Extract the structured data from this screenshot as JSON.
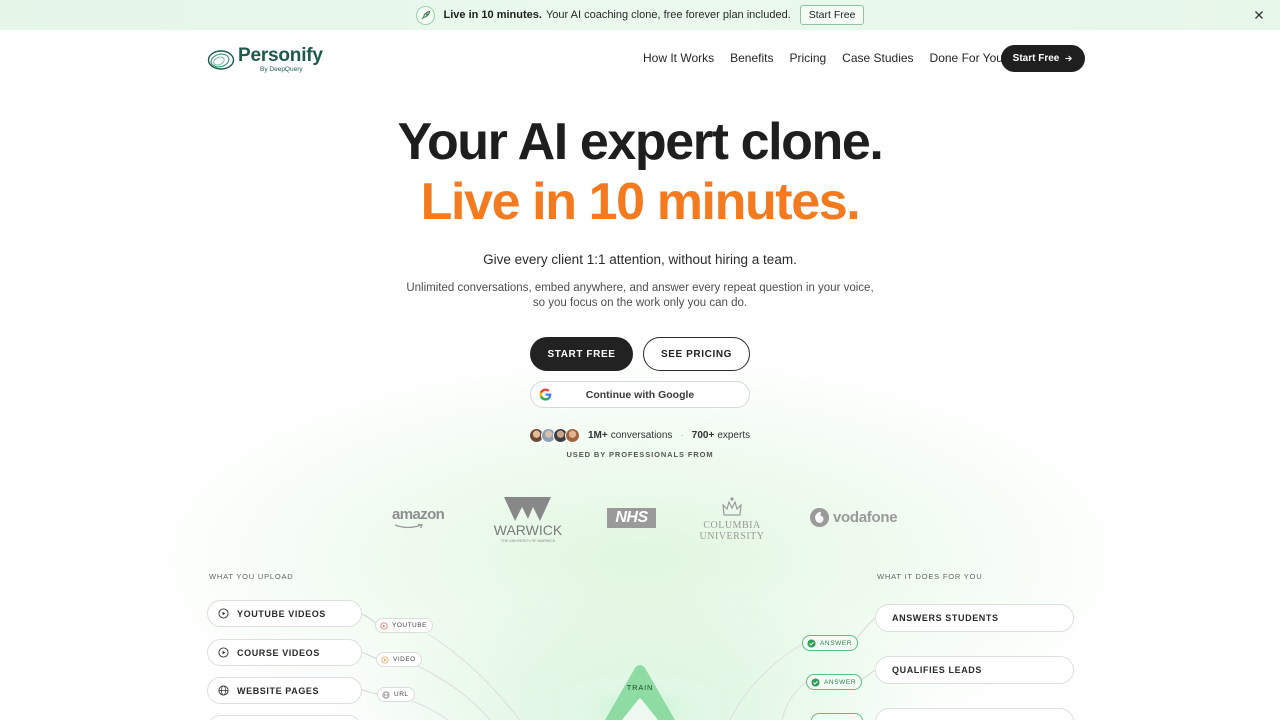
{
  "announcement": {
    "strong": "Live in 10 minutes.",
    "message": "Your AI coaching clone, free forever plan included.",
    "cta": "Start Free",
    "icon": "rocket-icon",
    "close_icon": "close-icon"
  },
  "brand": {
    "name": "Personify",
    "byline": "By DeepQuery",
    "color": "#1d5a4a"
  },
  "nav": {
    "links": [
      "How It Works",
      "Benefits",
      "Pricing",
      "Case Studies",
      "Done For You"
    ],
    "cta": "Start Free"
  },
  "hero": {
    "title_line1": "Your AI expert clone.",
    "title_line2": "Live in 10 minutes.",
    "accent_color": "#f47a20",
    "subhead": "Give every client 1:1 attention, without hiring a team.",
    "subtext_line1": "Unlimited conversations, embed anywhere, and answer every repeat question in your voice,",
    "subtext_line2": "so you focus on the work only you can do.",
    "primary_cta": "START FREE",
    "secondary_cta": "SEE PRICING",
    "google_cta": "Continue with Google"
  },
  "social_proof": {
    "conversations_value": "1M+",
    "conversations_label": "conversations",
    "experts_value": "700+",
    "experts_label": "experts",
    "separator": "·",
    "used_by": "USED BY PROFESSIONALS FROM"
  },
  "client_logos": {
    "amazon": "amazon",
    "warwick": "WARWICK",
    "warwick_sub": "THE UNIVERSITY OF WARWICK",
    "nhs": "NHS",
    "columbia_line1": "COLUMBIA",
    "columbia_line2": "UNIVERSITY",
    "vodafone": "vodafone"
  },
  "upload_section": {
    "label": "WHAT YOU UPLOAD",
    "items": [
      {
        "label": "YOUTUBE VIDEOS",
        "icon": "play-icon",
        "tag": "YOUTUBE",
        "tag_icon": "youtube-icon"
      },
      {
        "label": "COURSE VIDEOS",
        "icon": "play-icon",
        "tag": "VIDEO",
        "tag_icon": "video-icon"
      },
      {
        "label": "WEBSITE PAGES",
        "icon": "globe-icon",
        "tag": "URL",
        "tag_icon": "globe-icon"
      }
    ]
  },
  "train": {
    "label": "TRAIN"
  },
  "outcome_section": {
    "label": "WHAT IT DOES FOR YOU",
    "items": [
      {
        "label": "ANSWERS STUDENTS",
        "tag": "ANSWER"
      },
      {
        "label": "QUALIFIES LEADS",
        "tag": "ANSWER"
      }
    ]
  }
}
